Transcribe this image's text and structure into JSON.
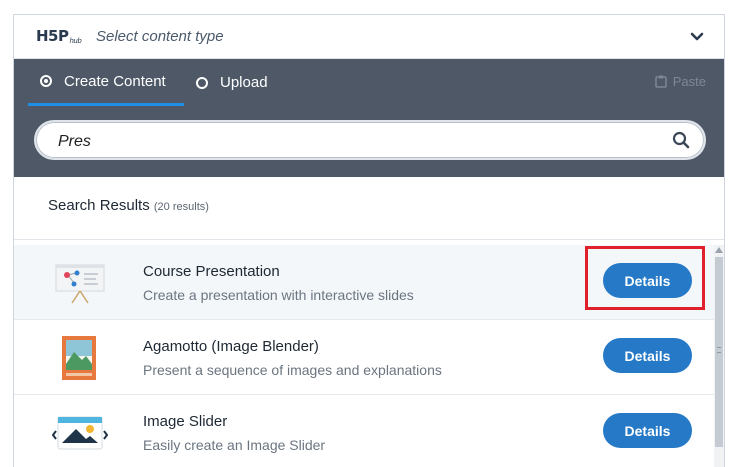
{
  "header": {
    "logo_text": "H5P",
    "logo_sub": "hub",
    "title": "Select content type"
  },
  "tabs": {
    "create_label": "Create Content",
    "upload_label": "Upload",
    "paste_label": "Paste"
  },
  "search": {
    "value": "Pres",
    "placeholder": ""
  },
  "results": {
    "title": "Search Results",
    "count": "(20 results)"
  },
  "items": [
    {
      "title": "Course Presentation",
      "description": "Create a presentation with interactive slides",
      "button": "Details"
    },
    {
      "title": "Agamotto (Image Blender)",
      "description": "Present a sequence of images and explanations",
      "button": "Details"
    },
    {
      "title": "Image Slider",
      "description": "Easily create an Image Slider",
      "button": "Details"
    }
  ],
  "colors": {
    "tab_bar": "#4e5866",
    "active_tab_underline": "#1f8fe3",
    "button": "#2579c6",
    "highlight": "#e0202a"
  }
}
